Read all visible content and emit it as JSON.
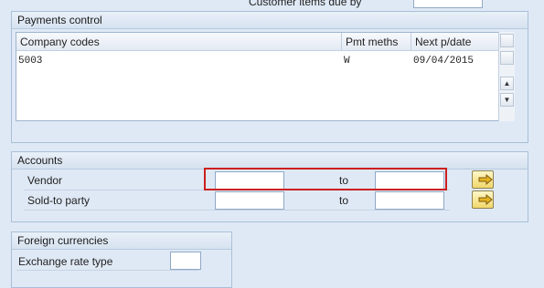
{
  "top_section": {
    "partial_label": "Customer items due by",
    "field_value": ""
  },
  "payments_control": {
    "title": "Payments control",
    "columns": [
      "Company codes",
      "Pmt meths",
      "Next p/date"
    ],
    "rows": [
      {
        "company_codes": "5003",
        "pmt_meths": "W",
        "next_p_date": "09/04/2015"
      }
    ]
  },
  "accounts": {
    "title": "Accounts",
    "vendor_label": "Vendor",
    "vendor_from": "",
    "vendor_to_label": "to",
    "vendor_to": "",
    "sold_to_label": "Sold-to party",
    "sold_to_from": "",
    "sold_to_to_label": "to",
    "sold_to_to": ""
  },
  "foreign_currencies": {
    "title": "Foreign currencies",
    "exchange_rate_label": "Exchange rate type",
    "exchange_rate_value": ""
  },
  "colors": {
    "highlight_border": "#cc1f1f",
    "background": "#dfe9f5"
  },
  "icons": {
    "scroll_up": "triangle-up",
    "scroll_down": "triangle-down",
    "multiple_selection": "arrow-right-icon"
  }
}
